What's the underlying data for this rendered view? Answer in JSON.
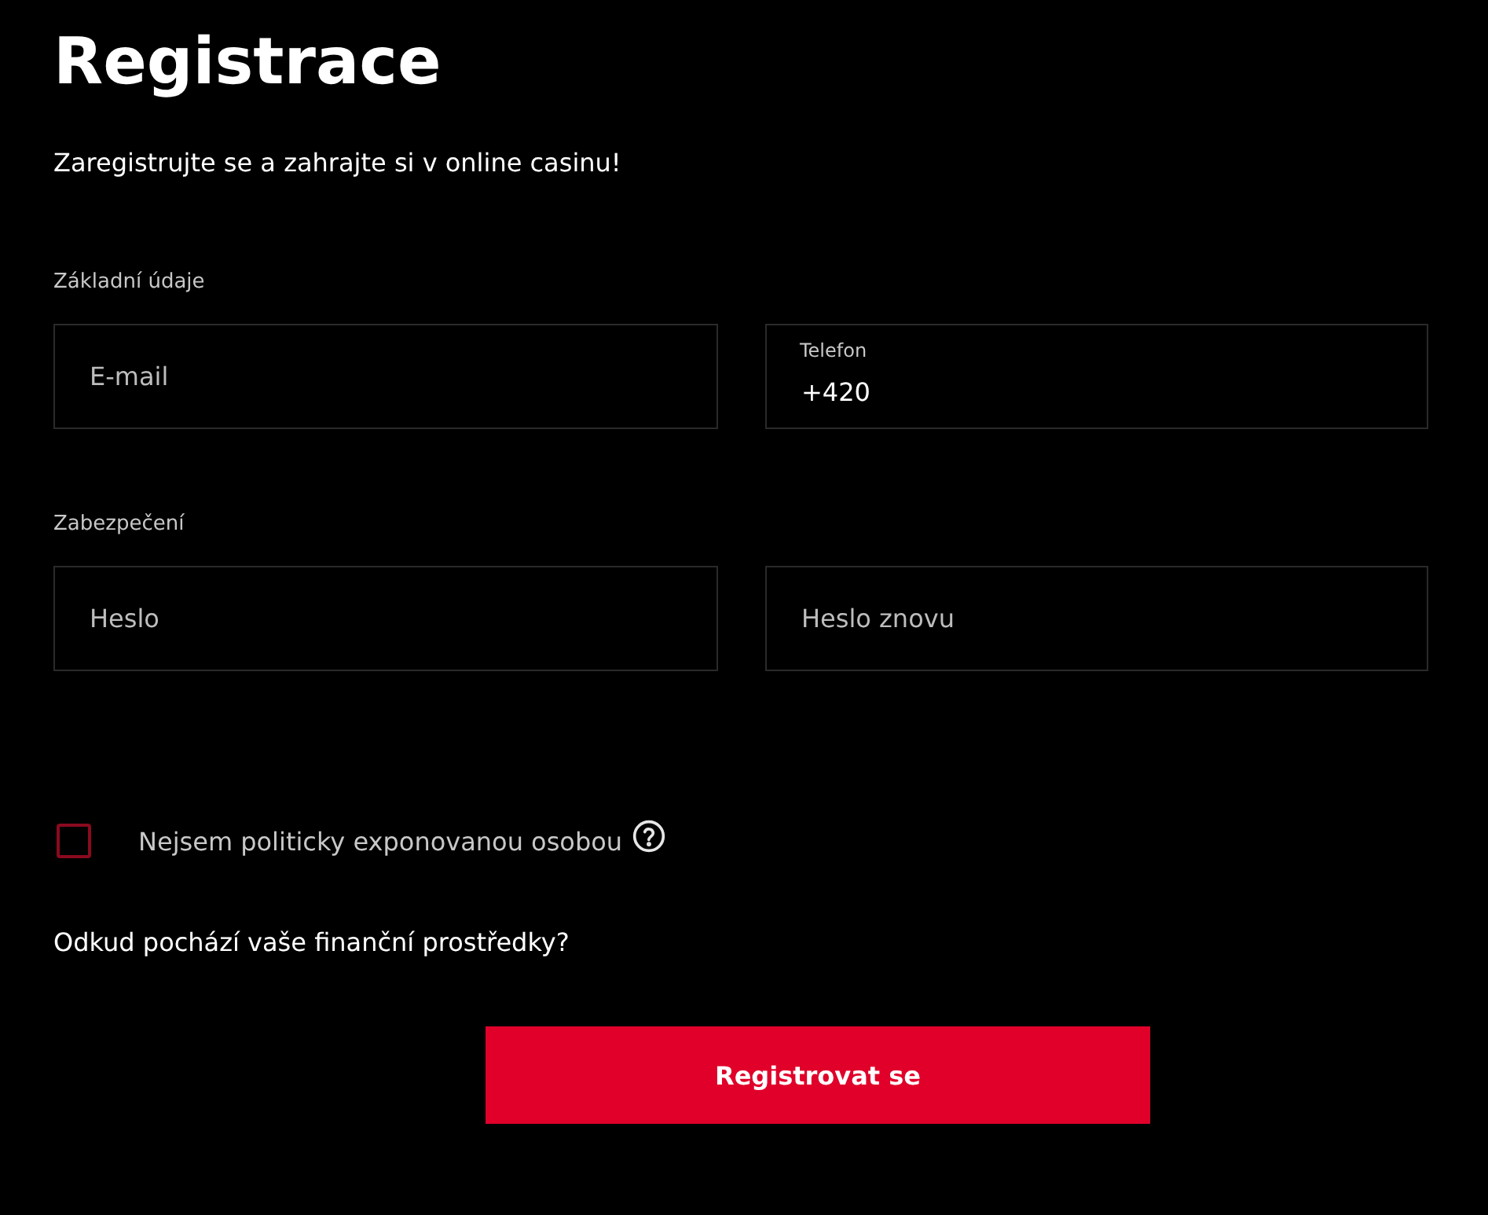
{
  "title": "Registrace",
  "subtitle": "Zaregistrujte se a zahrajte si v online casinu!",
  "sections": [
    {
      "label": "Základní údaje",
      "fields": [
        {
          "placeholder": "E-mail"
        },
        {
          "label": "Telefon",
          "value": "+420"
        }
      ]
    },
    {
      "label": "Zabezpečení",
      "fields": [
        {
          "placeholder": "Heslo"
        },
        {
          "placeholder": "Heslo znovu"
        }
      ]
    }
  ],
  "pep_checkbox": {
    "label": "Nejsem politicky exponovanou osobou",
    "checked": false
  },
  "funds_question": "Odkud pochází vaše finanční prostředky?",
  "submit_button": "Registrovat se"
}
